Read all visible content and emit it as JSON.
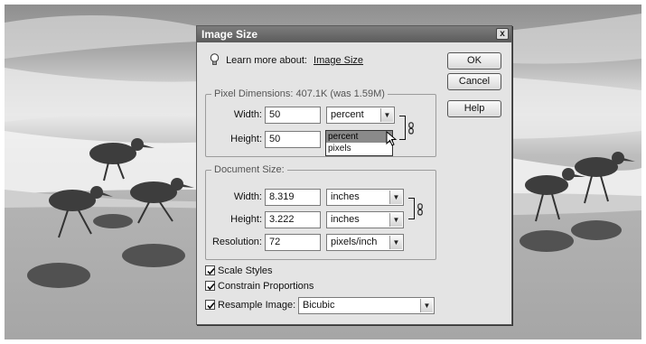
{
  "dialog": {
    "title": "Image Size",
    "close_glyph": "x",
    "learn_prefix": "Learn more about:",
    "learn_link": "Image Size"
  },
  "buttons": {
    "ok": "OK",
    "cancel": "Cancel",
    "help": "Help"
  },
  "pixel_dimensions": {
    "title": "Pixel Dimensions:",
    "size": "407.1K (was 1.59M)",
    "width_label": "Width:",
    "width_value": "50",
    "width_unit": "percent",
    "height_label": "Height:",
    "height_value": "50",
    "unit_options": [
      "percent",
      "pixels"
    ],
    "highlighted_option": "percent"
  },
  "document_size": {
    "title": "Document Size:",
    "width_label": "Width:",
    "width_value": "8.319",
    "width_unit": "inches",
    "height_label": "Height:",
    "height_value": "3.222",
    "height_unit": "inches",
    "resolution_label": "Resolution:",
    "resolution_value": "72",
    "resolution_unit": "pixels/inch"
  },
  "options": {
    "scale_styles": {
      "label": "Scale Styles",
      "checked": true
    },
    "constrain_proportions": {
      "label": "Constrain Proportions",
      "checked": true
    },
    "resample_image": {
      "label": "Resample Image:",
      "checked": true,
      "method": "Bicubic"
    }
  },
  "icons": {
    "lightbulb": "lightbulb-icon",
    "chain": "chain-link-icon",
    "dropdown": "chevron-down-icon",
    "cursor": "mouse-pointer-icon"
  },
  "colors": {
    "dialog_bg": "#e4e4e4",
    "titlebar": "#666666",
    "highlight": "#8a8a8a"
  }
}
